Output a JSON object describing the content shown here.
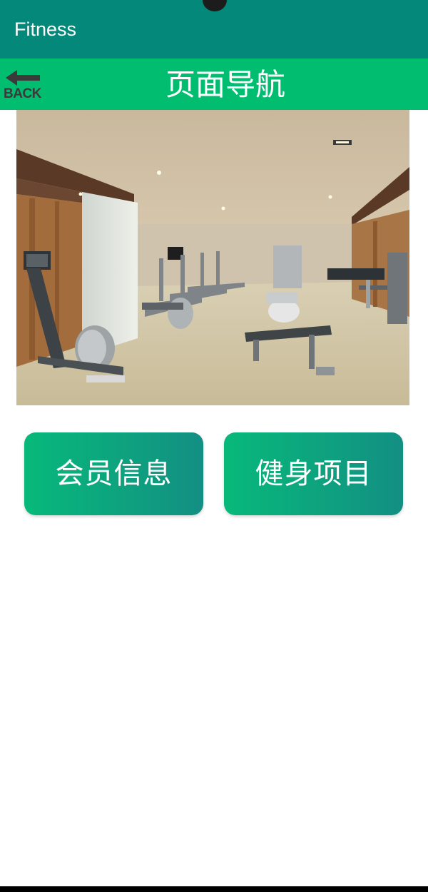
{
  "app_bar": {
    "title": "Fitness"
  },
  "nav_bar": {
    "back_label": "BACK",
    "title": "页面导航"
  },
  "hero_image": {
    "subject": "gym interior with treadmills, ellipticals and weight bench"
  },
  "buttons": {
    "member_info": "会员信息",
    "fitness_projects": "健身项目"
  },
  "colors": {
    "app_bar": "#04887a",
    "nav_bar": "#00bd70",
    "button_gradient_start": "#07b97a",
    "button_gradient_end": "#138f83"
  }
}
